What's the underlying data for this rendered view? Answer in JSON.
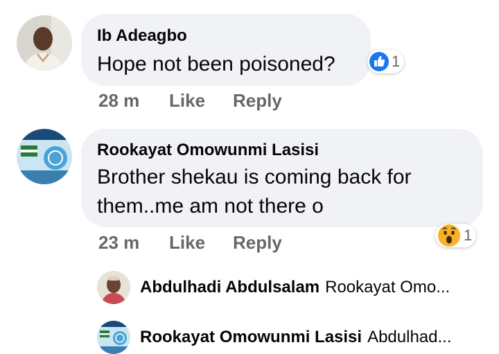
{
  "comments": [
    {
      "author": "Ib Adeagbo",
      "text_lines": [
        "Hope not been poisoned?"
      ],
      "time": "28 m",
      "like_label": "Like",
      "reply_label": "Reply",
      "reaction": {
        "icon": "like-icon",
        "count": "1",
        "color": "#1877f2"
      }
    },
    {
      "author": "Rookayat Omowunmi Lasisi",
      "text_lines": [
        "Brother shekau is coming back for",
        "them..me am not there o"
      ],
      "time": "23 m",
      "like_label": "Like",
      "reply_label": "Reply",
      "reaction": {
        "icon": "wow-icon",
        "count": "1",
        "color": "#f7b125"
      }
    }
  ],
  "replies": [
    {
      "author": "Abdulhadi Abdulsalam",
      "snippet": "Rookayat Omo..."
    },
    {
      "author": "Rookayat Omowunmi Lasisi",
      "snippet": "Abdulhad..."
    }
  ]
}
